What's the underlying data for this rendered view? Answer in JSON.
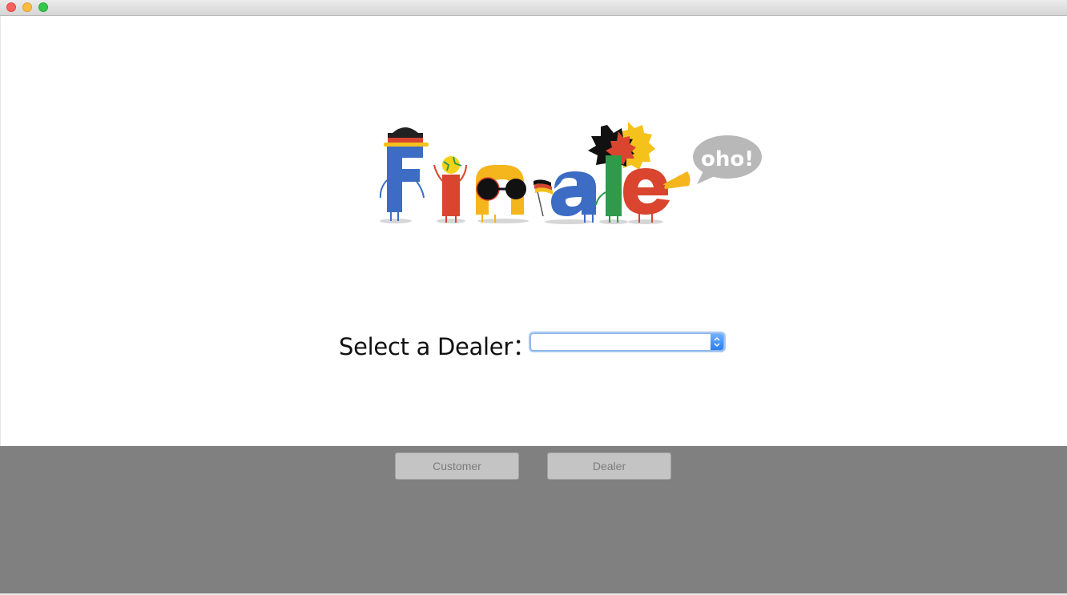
{
  "window": {
    "controls": [
      "close",
      "minimize",
      "maximize"
    ]
  },
  "logo": {
    "letters": [
      "F",
      "i",
      "n",
      "a",
      "l",
      "e"
    ],
    "speech_bubble": "oho!"
  },
  "form": {
    "select_label": "Select a Dealer：",
    "dealer_select_value": ""
  },
  "footer": {
    "customer_label": "Customer",
    "dealer_label": "Dealer"
  },
  "colors": {
    "blue": "#3d6cc4",
    "red": "#d9452f",
    "yellow": "#f5b51c",
    "green": "#2f9a4a",
    "footer_bg": "#808080"
  }
}
